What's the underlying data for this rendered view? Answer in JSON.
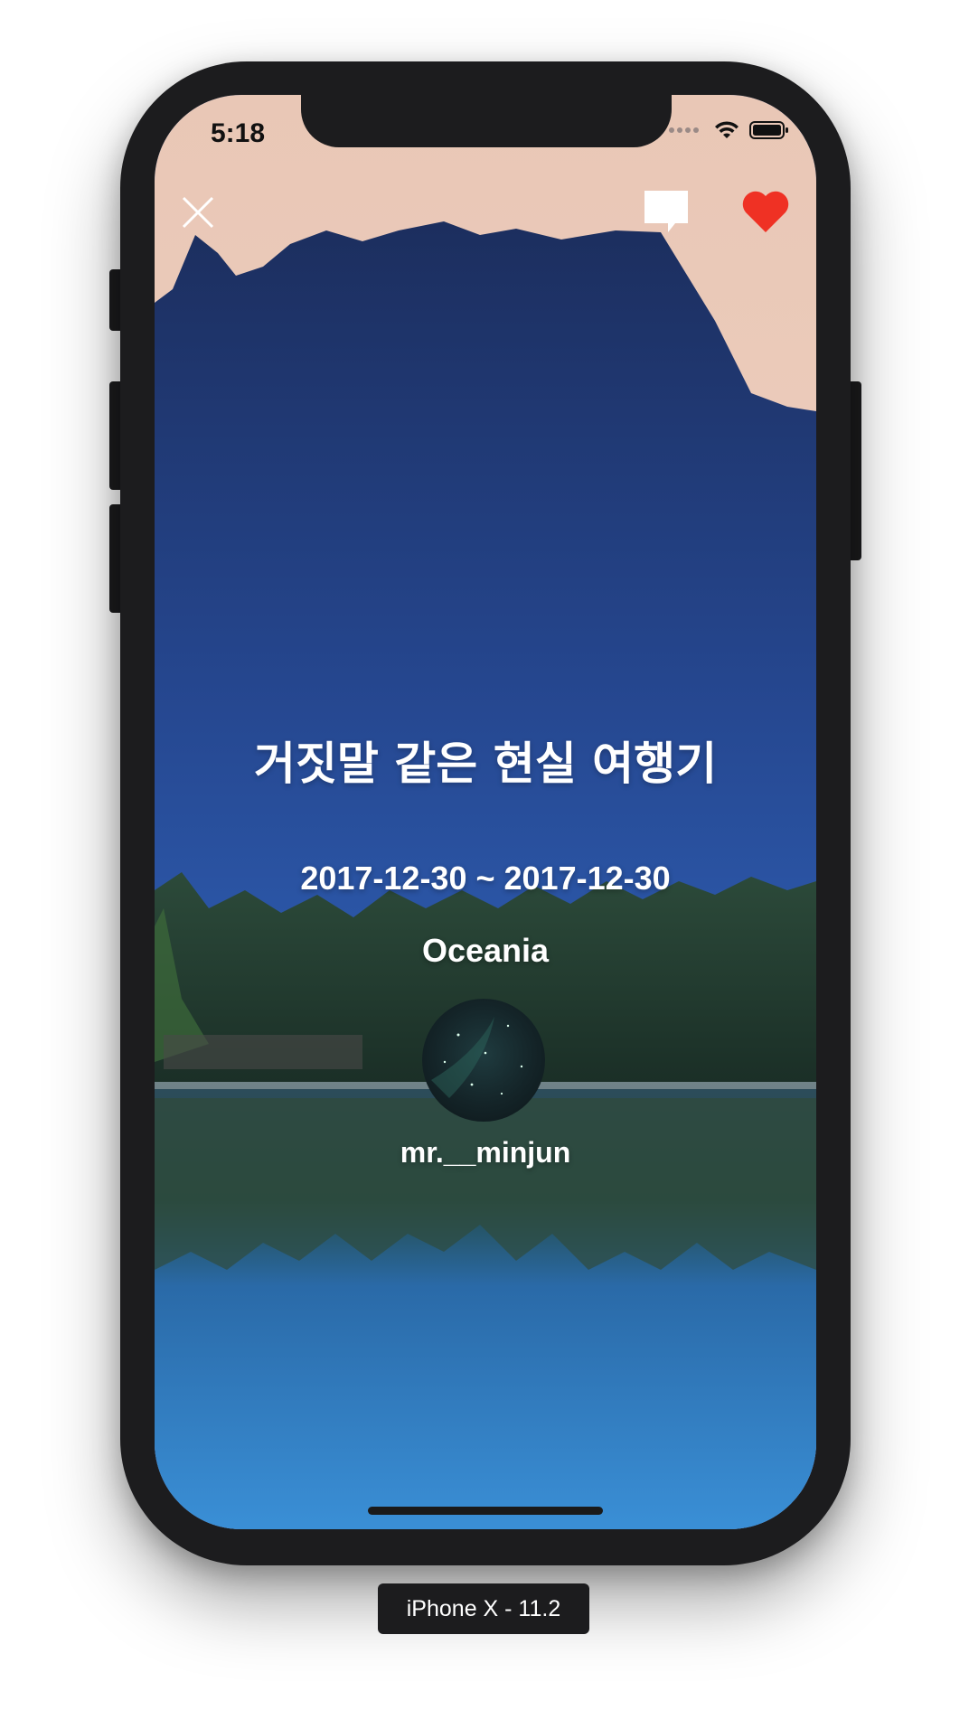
{
  "status_bar": {
    "time": "5:18"
  },
  "nav": {
    "close_icon": "close-icon",
    "comment_icon": "comment-icon",
    "like_icon": "heart-icon",
    "like_color": "#ef3124"
  },
  "trip": {
    "title": "거짓말 같은 현실 여행기",
    "date_range": "2017-12-30 ~ 2017-12-30",
    "region": "Oceania",
    "author": "mr.__minjun"
  },
  "simulator": {
    "device_label": "iPhone X - 11.2"
  }
}
